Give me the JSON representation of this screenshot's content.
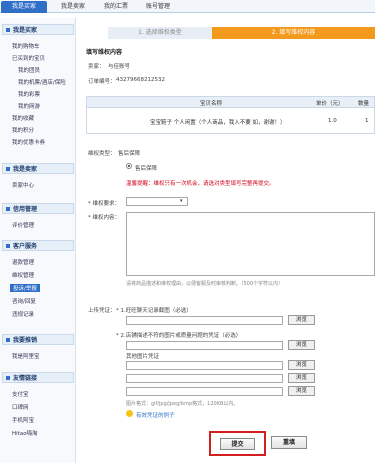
{
  "topnav": {
    "tabs": [
      {
        "label": "我是买家",
        "active": true
      },
      {
        "label": "我是卖家",
        "active": false
      },
      {
        "label": "我的汇票",
        "active": false
      },
      {
        "label": "账号管理",
        "active": false
      }
    ]
  },
  "sidebar": {
    "sections": [
      {
        "title": "我是买家",
        "items": [
          "我的购物车",
          "已买到的宝贝",
          "我的团员",
          "我的机票/酒店/保险",
          "我的彩票",
          "我的网游",
          "我的收藏",
          "我的积分",
          "我的优惠卡券"
        ]
      },
      {
        "title": "我是卖家",
        "items": [
          "卖家中心"
        ]
      },
      {
        "title": "信用管理",
        "items": [
          "评价管理"
        ]
      },
      {
        "title": "客户服务",
        "items": [
          "退款管理",
          "维权管理",
          "投诉/举报",
          "咨询/回复",
          "违规记录"
        ]
      },
      {
        "title": "我要推销",
        "items": [
          "我是阿里宝"
        ]
      },
      {
        "title": "友情链接",
        "items": [
          "支付宝",
          "口碑网",
          "手机阿宝",
          "Hitao嗨淘"
        ]
      }
    ]
  },
  "steps": {
    "step1": "1. 选择维权类型",
    "step2": "2. 填写维权内容"
  },
  "form": {
    "section_title": "填写维权内容",
    "seller_label": "卖家：",
    "seller_value": "与佳账号",
    "order_label": "订单编号：",
    "order_value": "43279668212532",
    "table": {
      "headers": [
        "宝贝名称",
        "单价（元）",
        "数量"
      ],
      "row": {
        "name": "宝宝鞋子 个人闲置（个人商品，我入不要 如，谢谢！）",
        "price": "1.0",
        "qty": "1"
      }
    },
    "type_label": "维权类型：",
    "type_value": "售后保障",
    "radio_label": "售后保障",
    "warning": "温馨提醒：维权只有一次机会，请选对类型填写完整再提交。",
    "request_label": "* 维权要求：",
    "content_label": "* 维权内容：",
    "content_hint": "请将商品描述和维权理由，以便客服及时审核判断。（500个字符以内）",
    "upload_label": "上传凭证：",
    "upload1_label": "* 1.旺旺聊天记录截图（必选）",
    "upload2_label": "* 2.店铺描述不符的图片或质量问题的凭证（必选）",
    "other_label": "其他图片凭证",
    "format_hint": "图片格式：gif/jpg/jpeg/bmp格式，120KB以内。",
    "example_link": "有效凭证的例子",
    "browse_label": "浏览",
    "submit_label": "提交",
    "reset_label": "重填"
  }
}
